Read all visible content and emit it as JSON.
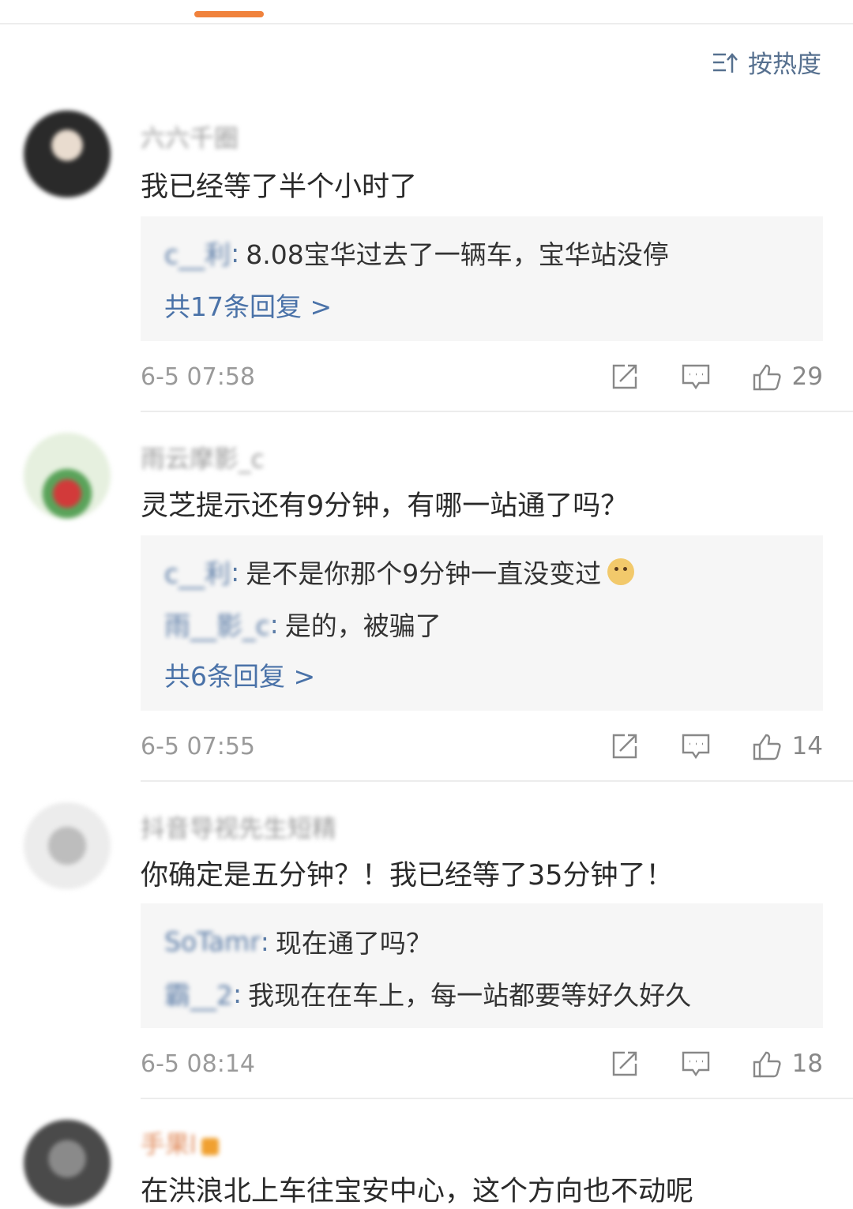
{
  "sort": {
    "label": "按热度"
  },
  "comments": [
    {
      "username": "六六千圈",
      "avatar_color": "#3a3a3a",
      "text": "我已经等了半个小时了",
      "replies": [
        {
          "name": "c__利",
          "text": "8.08宝华过去了一辆车，宝华站没停"
        }
      ],
      "more": "共17条回复 >",
      "time": "6-5 07:58",
      "likes": "29"
    },
    {
      "username": "雨云摩影_c",
      "avatar_color": "#8bbf74",
      "text": "灵芝提示还有9分钟，有哪一站通了吗？",
      "replies": [
        {
          "name": "c__利",
          "text": "是不是你那个9分钟一直没变过"
        },
        {
          "name": "雨__影_c",
          "text": "是的，被骗了"
        }
      ],
      "more": "共6条回复 >",
      "time": "6-5 07:55",
      "likes": "14"
    },
    {
      "username": "抖音导视先生短精",
      "avatar_color": "#d5d5d5",
      "text": "你确定是五分钟？！我已经等了35分钟了！",
      "replies": [
        {
          "name": "SoTamr",
          "text": "现在通了吗？"
        },
        {
          "name": "霸__2",
          "text": "我现在在车上，每一站都要等好久好久"
        }
      ],
      "more": "",
      "time": "6-5 08:14",
      "likes": "18"
    },
    {
      "username": "手果l",
      "avatar_color": "#6e6e6e",
      "text": "在洪浪北上车往宝安中心，这个方向也不动呢"
    }
  ]
}
